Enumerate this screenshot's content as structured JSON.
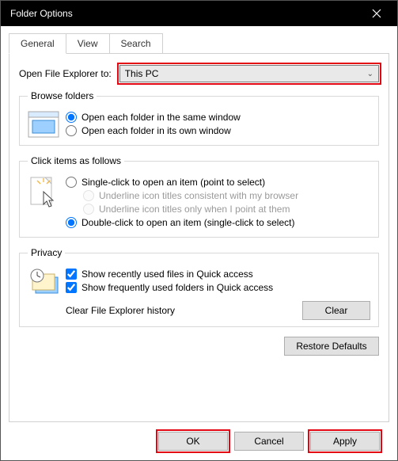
{
  "window": {
    "title": "Folder Options"
  },
  "tabs": {
    "general": "General",
    "view": "View",
    "search": "Search"
  },
  "openExplorer": {
    "label": "Open File Explorer to:",
    "value": "This PC"
  },
  "browseFolders": {
    "legend": "Browse folders",
    "opt_same": "Open each folder in the same window",
    "opt_own": "Open each folder in its own window"
  },
  "clickItems": {
    "legend": "Click items as follows",
    "opt_single": "Single-click to open an item (point to select)",
    "opt_underline_browser": "Underline icon titles consistent with my browser",
    "opt_underline_point": "Underline icon titles only when I point at them",
    "opt_double": "Double-click to open an item (single-click to select)"
  },
  "privacy": {
    "legend": "Privacy",
    "chk_recent": "Show recently used files in Quick access",
    "chk_frequent": "Show frequently used folders in Quick access",
    "clear_label": "Clear File Explorer history",
    "clear_btn": "Clear"
  },
  "restore_defaults": "Restore Defaults",
  "footer": {
    "ok": "OK",
    "cancel": "Cancel",
    "apply": "Apply"
  }
}
